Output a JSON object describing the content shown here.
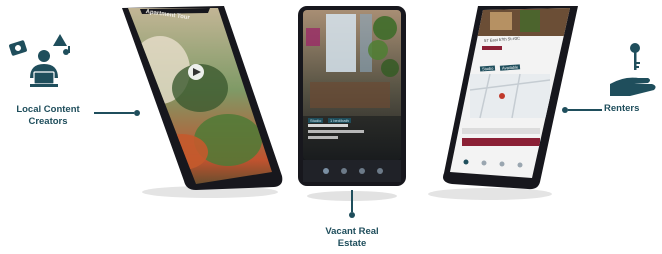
{
  "colors": {
    "accent": "#1f4e5c",
    "phone_body": "#17171d",
    "brand_red": "#8b2035",
    "shadow": "#d9d9d9"
  },
  "labels": {
    "creators": "Local Content\nCreators",
    "vacant": "Vacant Real\nEstate",
    "renters": "Renters"
  },
  "phone_left": {
    "header": "Apartment Tour"
  },
  "phone_middle": {
    "tags": [
      "Studio",
      "1 bed/bath"
    ]
  },
  "phone_right": {
    "address_line": "57 East 57th St #3C",
    "tags": [
      "Studio",
      "Available"
    ]
  },
  "icons": {
    "creators": "content-creator-icon",
    "renters": "key-hand-icon"
  }
}
